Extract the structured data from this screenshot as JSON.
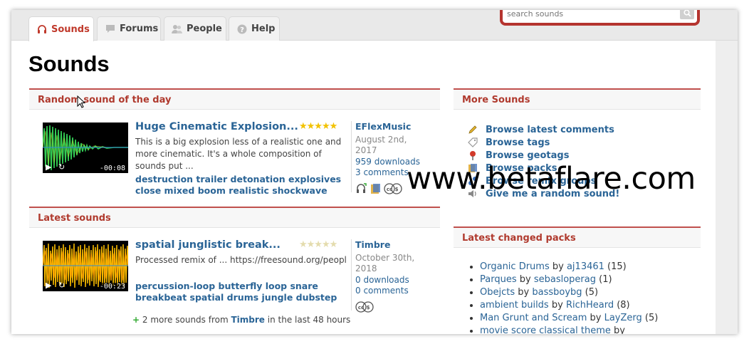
{
  "tabs": [
    {
      "label": "Sounds",
      "icon": "headphones-icon",
      "active": true
    },
    {
      "label": "Forums",
      "icon": "chat-icon"
    },
    {
      "label": "People",
      "icon": "people-icon"
    },
    {
      "label": "Help",
      "icon": "help-icon"
    }
  ],
  "search": {
    "placeholder": "search sounds"
  },
  "page_title": "Sounds",
  "random_sound": {
    "heading": "Random sound of the day",
    "title": "Huge Cinematic Explosion...",
    "rating": 5,
    "description": "This is a big explosion less of a realistic one and more cinematic. It's a whole composition of sounds put ...",
    "tags": "destruction trailer detonation explosives close mixed boom realistic shockwave",
    "author": "EFlexMusic",
    "date": "August 2nd, 2017",
    "downloads": "959 downloads",
    "comments": "3 comments",
    "duration": "-00:08",
    "wave_color": "#33cc55"
  },
  "latest_sounds": {
    "heading": "Latest sounds",
    "title": "spatial junglistic break...",
    "rating": 0,
    "description": "Processed remix of ... https://freesound.org/people/richiedejaneiro/sou",
    "tags": "percussion-loop butterfly loop snare breakbeat spatial drums jungle dubstep",
    "author": "Timbre",
    "date": "October 30th, 2018",
    "downloads": "0 downloads",
    "comments": "0 comments",
    "duration": "-00:23",
    "wave_color": "#f5b800",
    "more_prefix": "2 more sounds from",
    "more_author": "Timbre",
    "more_suffix": "in the last 48 hours"
  },
  "more_sounds": {
    "heading": "More Sounds",
    "items": [
      {
        "label": "Browse latest comments",
        "icon": "pencil-icon"
      },
      {
        "label": "Browse tags",
        "icon": "tag-icon"
      },
      {
        "label": "Browse geotags",
        "icon": "map-pin-icon"
      },
      {
        "label": "Browse packs",
        "icon": "folder-icon"
      },
      {
        "label": "Browse remix groups",
        "icon": "remix-icon"
      },
      {
        "label": "Give me a random sound!",
        "icon": "speaker-icon"
      }
    ]
  },
  "latest_packs": {
    "heading": "Latest changed packs",
    "items": [
      {
        "pack": "Organic Drums",
        "by": "by",
        "user": "aj13461",
        "count": "(15)"
      },
      {
        "pack": "Parques",
        "by": "by",
        "user": "sebasloperag",
        "count": "(1)"
      },
      {
        "pack": "Obejcts",
        "by": "by",
        "user": "bassboybg",
        "count": "(5)"
      },
      {
        "pack": "ambient builds",
        "by": "by",
        "user": "RichHeard",
        "count": "(8)"
      },
      {
        "pack": "Man Grunt and Scream",
        "by": "by",
        "user": "LayZerg",
        "count": "(5)"
      },
      {
        "pack": "movie score classical theme",
        "by": "by",
        "user": "",
        "count": ""
      }
    ]
  },
  "watermark": "www.betaflare.com",
  "colors": {
    "accent": "#c0392b",
    "link": "#2a6496",
    "star": "#f2c200"
  }
}
